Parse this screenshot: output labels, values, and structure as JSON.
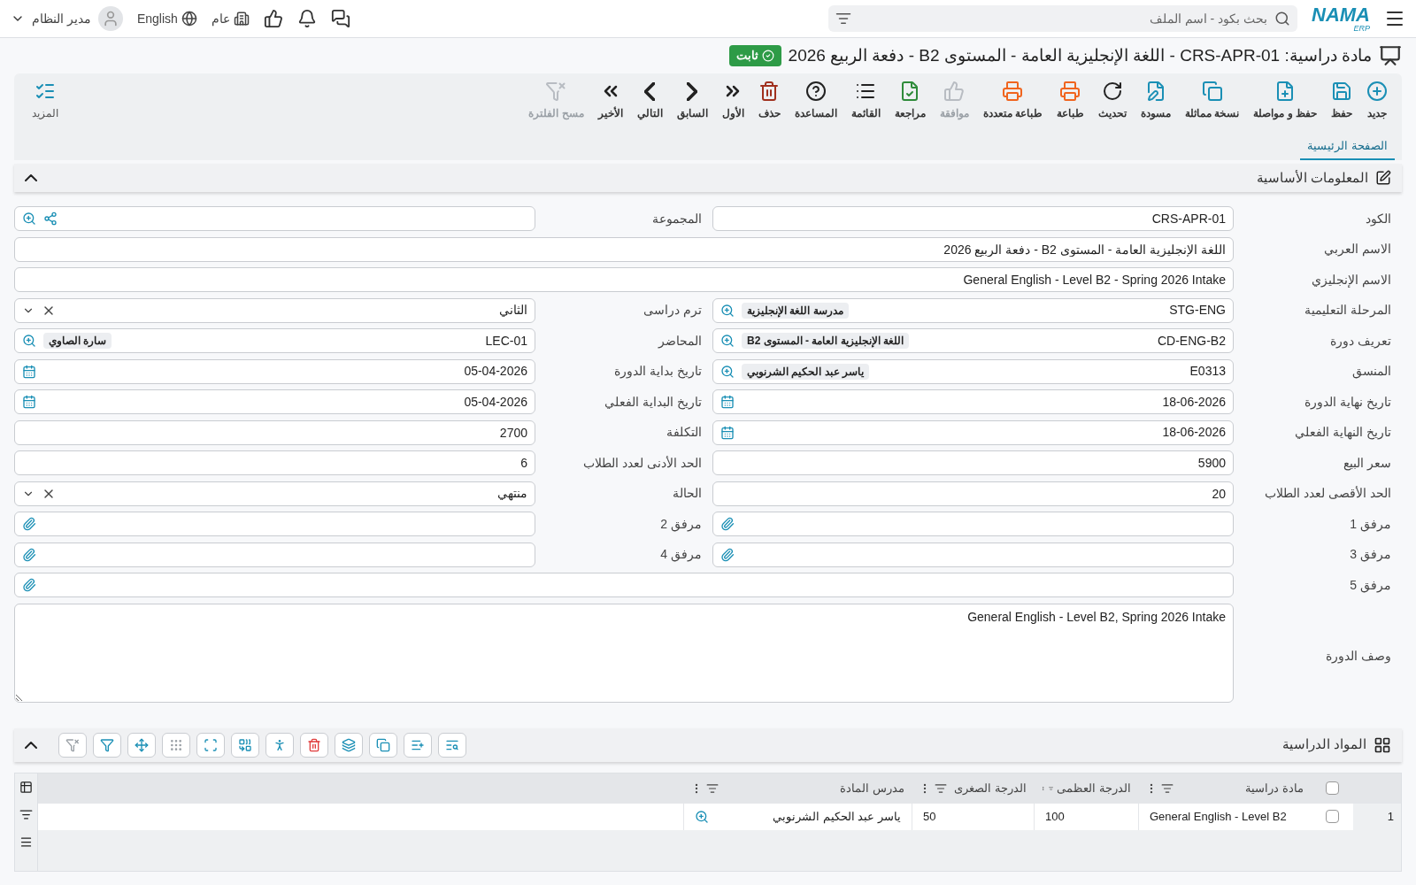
{
  "topbar": {
    "logo": "NAMA",
    "logo_sub": "ERP",
    "search": {
      "placeholder": "بحث بكود - اسم الملف"
    },
    "branch": "عام",
    "language": "English",
    "user": "مدير النظام"
  },
  "title": {
    "text": "مادة دراسية: CRS-APR-01 - اللغة الإنجليزية العامة - المستوى B2 - دفعة الربيع 2026",
    "status": "ثابت"
  },
  "toolbar": {
    "items": [
      {
        "label": "جديد",
        "kind": "new",
        "color": "#1a8fb5",
        "disabled": false
      },
      {
        "label": "حفظ",
        "kind": "save",
        "color": "#1a8fb5",
        "disabled": false
      },
      {
        "label": "حفظ و مواصلة",
        "kind": "save-continue",
        "color": "#1a8fb5",
        "disabled": false
      },
      {
        "label": "نسخة مماثلة",
        "kind": "copy",
        "color": "#1a8fb5",
        "disabled": false
      },
      {
        "label": "مسودة",
        "kind": "draft",
        "color": "#1a8fb5",
        "disabled": false
      },
      {
        "label": "تحديث",
        "kind": "refresh",
        "color": "#222222",
        "disabled": false
      },
      {
        "label": "طباعة",
        "kind": "print",
        "color": "#f0641e",
        "disabled": false
      },
      {
        "label": "طباعة متعددة",
        "kind": "print-multi",
        "color": "#f0641e",
        "disabled": false
      },
      {
        "label": "موافقة",
        "kind": "approve",
        "disabled": true
      },
      {
        "label": "مراجعة",
        "kind": "review",
        "color": "#2e8b3a",
        "disabled": false
      },
      {
        "label": "القائمة",
        "kind": "list",
        "color": "#222222",
        "disabled": false
      },
      {
        "label": "المساعدة",
        "kind": "help",
        "color": "#222222",
        "disabled": false
      },
      {
        "label": "حذف",
        "kind": "delete",
        "color": "#a0301e",
        "disabled": false
      },
      {
        "label": "الأول",
        "kind": "first",
        "color": "#222222",
        "disabled": false
      },
      {
        "label": "السابق",
        "kind": "prev",
        "color": "#222222",
        "disabled": false
      },
      {
        "label": "التالي",
        "kind": "next",
        "color": "#222222",
        "disabled": false
      },
      {
        "label": "الأخير",
        "kind": "last",
        "color": "#222222",
        "disabled": false
      },
      {
        "label": "مسح الفلترة",
        "kind": "clear-filter",
        "disabled": true
      }
    ],
    "more": "المزيد"
  },
  "tabs": [
    {
      "label": "الصفحة الرئيسية",
      "selected": true
    }
  ],
  "basic_section": {
    "title": "المعلومات الأساسية",
    "expanded": true,
    "rows": [
      [
        {
          "label": "الكود",
          "kind": "text",
          "value": "CRS-APR-01"
        },
        {
          "label": "المجموعة",
          "kind": "lookup-share"
        }
      ],
      [
        {
          "label": "الاسم العربي",
          "kind": "text",
          "value": "اللغة الإنجليزية العامة - المستوى B2 - دفعة الربيع 2026"
        }
      ],
      [
        {
          "label": "الاسم الإنجليزي",
          "kind": "text",
          "value": "General English - Level B2 - Spring 2026 Intake"
        }
      ],
      [
        {
          "label": "المرحلة التعليمية",
          "kind": "lookup",
          "value": "STG-ENG",
          "chip": "مدرسة اللغة الإنجليزية"
        },
        {
          "label": "ترم دراسى",
          "kind": "select",
          "value": "الثاني"
        }
      ],
      [
        {
          "label": "تعريف دورة",
          "kind": "lookup",
          "value": "CD-ENG-B2",
          "chip": "اللغة الإنجليزية العامة - المستوى B2"
        },
        {
          "label": "المحاضر",
          "kind": "lookup",
          "value": "LEC-01",
          "chip": "سارة الصاوي"
        }
      ],
      [
        {
          "label": "المنسق",
          "kind": "lookup",
          "value": "E0313",
          "chip": "ياسر عبد الحكيم الشرنوبي"
        },
        {
          "label": "تاريخ بداية الدورة",
          "kind": "date",
          "value": "05-04-2026"
        }
      ],
      [
        {
          "label": "تاريخ نهاية الدورة",
          "kind": "date",
          "value": "18-06-2026"
        },
        {
          "label": "تاريخ البداية الفعلي",
          "kind": "date",
          "value": "05-04-2026"
        }
      ],
      [
        {
          "label": "تاريخ النهاية الفعلي",
          "kind": "date",
          "value": "18-06-2026"
        },
        {
          "label": "التكلفة",
          "kind": "text",
          "value": "2700"
        }
      ],
      [
        {
          "label": "سعر البيع",
          "kind": "text",
          "value": "5900"
        },
        {
          "label": "الحد الأدنى لعدد الطلاب",
          "kind": "text",
          "value": "6"
        }
      ],
      [
        {
          "label": "الحد الأقصى لعدد الطلاب",
          "kind": "text",
          "value": "20"
        },
        {
          "label": "الحالة",
          "kind": "select",
          "value": "منتهي"
        }
      ],
      [
        {
          "label": "مرفق 1",
          "kind": "attachment"
        },
        {
          "label": "مرفق 2",
          "kind": "attachment"
        }
      ],
      [
        {
          "label": "مرفق 3",
          "kind": "attachment"
        },
        {
          "label": "مرفق 4",
          "kind": "attachment"
        }
      ],
      [
        {
          "label": "مرفق 5",
          "kind": "attachment"
        }
      ],
      [
        {
          "label": "وصف الدورة",
          "kind": "textarea",
          "value": "General English - Level B2, Spring 2026 Intake"
        }
      ]
    ]
  },
  "grid_section": {
    "title": "المواد الدراسية",
    "expanded": true,
    "tools": [
      {
        "kind": "search-list",
        "disabled": false
      },
      {
        "kind": "add-row",
        "disabled": false
      },
      {
        "kind": "copy",
        "disabled": false
      },
      {
        "kind": "layers",
        "disabled": false
      },
      {
        "kind": "delete",
        "disabled": false
      },
      {
        "kind": "run",
        "disabled": false
      },
      {
        "kind": "merge",
        "disabled": false
      },
      {
        "kind": "fit",
        "disabled": false
      },
      {
        "kind": "grip",
        "disabled": true
      },
      {
        "kind": "move",
        "disabled": false
      },
      {
        "kind": "filter",
        "disabled": false
      },
      {
        "kind": "clear-filter",
        "disabled": true
      }
    ],
    "all_checked": false,
    "columns": [
      "مادة دراسية",
      "الدرجة العظمى",
      "الدرجة الصغرى",
      "مدرس المادة"
    ],
    "rows": [
      {
        "number": "1",
        "checked": false,
        "cells": [
          "General English - Level B2",
          "100",
          "50",
          "ياسر عبد الحكيم الشرنوبي"
        ]
      }
    ]
  }
}
